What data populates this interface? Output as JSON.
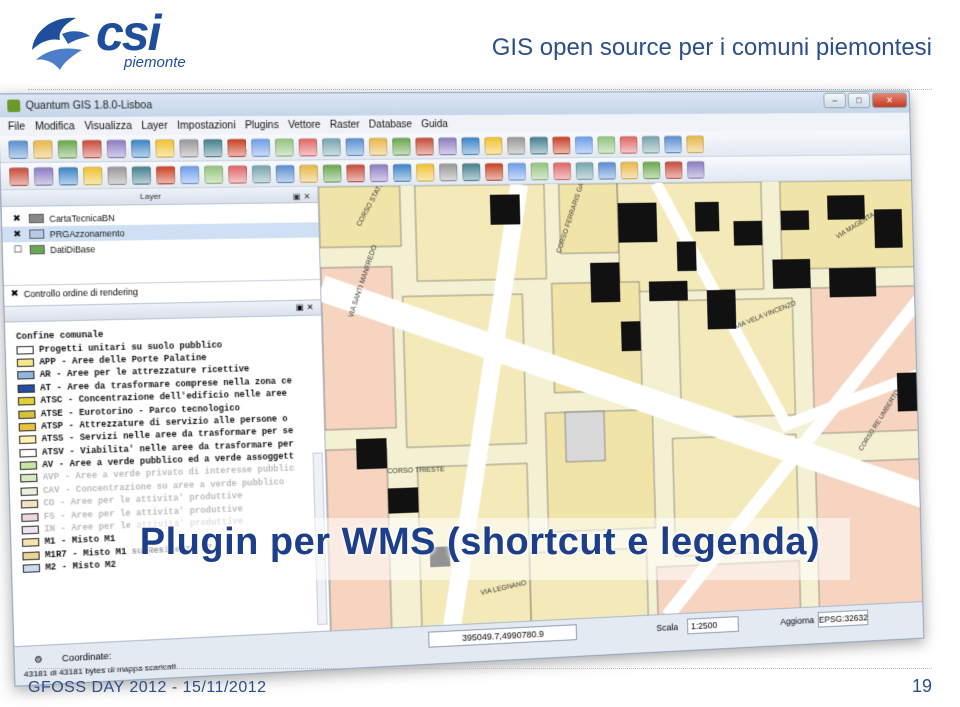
{
  "slide": {
    "logo_text": "csi",
    "logo_sub": "piemonte",
    "title": "GIS open source per i comuni piemontesi",
    "footer": "GFOSS DAY 2012  -  15/11/2012",
    "page_number": "19",
    "overlay_caption": "Plugin per WMS (shortcut e legenda)"
  },
  "app": {
    "window_title": "Quantum GIS 1.8.0-Lisboa",
    "menu": [
      "File",
      "Modifica",
      "Visualizza",
      "Layer",
      "Impostazioni",
      "Plugins",
      "Vettore",
      "Raster",
      "Database",
      "Guida"
    ],
    "layer_panel_title": "Layer",
    "layers": [
      {
        "label": "CartaTecnicaBN",
        "checked": true
      },
      {
        "label": "PRGAzzonamento",
        "checked": true
      },
      {
        "label": "DatiDiBase",
        "checked": false
      }
    ],
    "render_order_label": "Controllo ordine di rendering",
    "legend": [
      {
        "label": "Confine comunale",
        "color": "#ffffff",
        "faded": false
      },
      {
        "label": "Progetti unitari su suolo pubblico",
        "color": "#ffffff",
        "faded": false
      },
      {
        "label": "APP - Aree delle Porte Palatine",
        "color": "#f7e68a",
        "faded": false
      },
      {
        "label": "AR - Aree per le attrezzature ricettive",
        "color": "#8fb7e0",
        "faded": false
      },
      {
        "label": "AT - Aree da trasformare comprese nella zona ce",
        "color": "#1f4fa3",
        "faded": false
      },
      {
        "label": "ATSC - Concentrazione dell'edificio nelle aree",
        "color": "#e3cf3a",
        "faded": false
      },
      {
        "label": "ATSE - Eurotorino - Parco tecnologico",
        "color": "#d9c23a",
        "faded": false
      },
      {
        "label": "ATSP - Attrezzature di servizio alle persone o",
        "color": "#e8c23f",
        "faded": false
      },
      {
        "label": "ATSS - Servizi nelle aree da trasformare per se",
        "color": "#fff1b0",
        "faded": false
      },
      {
        "label": "ATSV - Viabilita' nelle aree da trasformare per",
        "color": "#ffffff",
        "faded": false
      },
      {
        "label": "AV - Aree a verde pubblico ed a verde assoggett",
        "color": "#c6e6a4",
        "faded": false
      },
      {
        "label": "AVP - Aree a verde privato di interesse pubblic",
        "color": "#d4ecc0",
        "faded": true
      },
      {
        "label": "CAV - Concentrazione su aree a verde pubblico",
        "color": "#e6f3da",
        "faded": true
      },
      {
        "label": "CO - Aree per le attivita' produttive",
        "color": "#f2e3c2",
        "faded": true
      },
      {
        "label": "FS - Aree per le attivita' produttive",
        "color": "#f0d7d7",
        "faded": true
      },
      {
        "label": "IN - Aree per le attivita' produttive",
        "color": "#efe3ef",
        "faded": true
      },
      {
        "label": "M1 - Misto M1",
        "color": "#f6e3b0",
        "faded": false
      },
      {
        "label": "M1R7 - Misto M1 su Residenza R7",
        "color": "#e8d497",
        "faded": false
      },
      {
        "label": "M2 - Misto M2",
        "color": "#c9dcef",
        "faded": false
      }
    ],
    "status": {
      "message": "43181 di 43181 bytes di mappa scaricati.",
      "coord_label": "Coordinate:",
      "coord_value": "395049.7,4990780.9",
      "scale_label": "Scala",
      "scale_value": "1:2500",
      "render_label": "Aggiorna",
      "crs": "EPSG:32632"
    },
    "street_labels": [
      "CORSO STATI UNITI",
      "CORSO FERRARIS GALILEO",
      "VIA VELA VINCENZO",
      "VIA MAGENTA",
      "CORSO TRIESTE",
      "VIA LEGNANO",
      "CORSO RE UMBERTO",
      "VIA SANTI MANFREDO"
    ]
  }
}
